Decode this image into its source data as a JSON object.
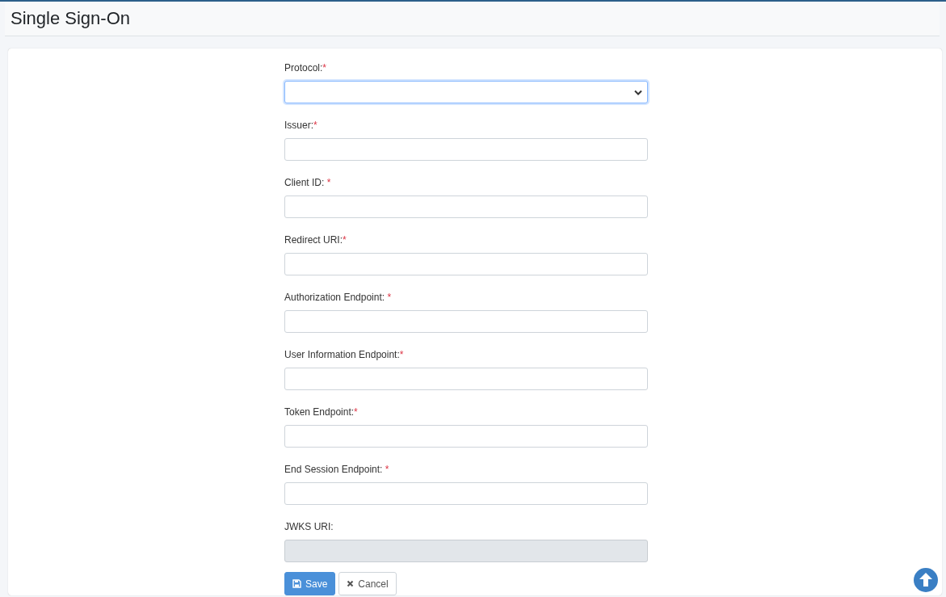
{
  "page_title": "Single Sign-On",
  "fields": [
    {
      "label": "Protocol:",
      "required_mark": "*",
      "kind": "select",
      "focused": true
    },
    {
      "label": "Issuer:",
      "required_mark": "*",
      "kind": "text",
      "disabled": false
    },
    {
      "label": "Client ID: ",
      "required_mark": "*",
      "kind": "text",
      "disabled": false
    },
    {
      "label": "Redirect URI:",
      "required_mark": "*",
      "kind": "text",
      "disabled": false
    },
    {
      "label": "Authorization Endpoint: ",
      "required_mark": "*",
      "kind": "text",
      "disabled": false
    },
    {
      "label": "User Information Endpoint:",
      "required_mark": "*",
      "kind": "text",
      "disabled": false
    },
    {
      "label": "Token Endpoint:",
      "required_mark": "*",
      "kind": "text",
      "disabled": false
    },
    {
      "label": "End Session Endpoint: ",
      "required_mark": "*",
      "kind": "text",
      "disabled": false
    },
    {
      "label": "JWKS URI:",
      "kind": "text",
      "disabled": true
    }
  ],
  "buttons": [
    {
      "label": "Save",
      "kind": "primary"
    },
    {
      "label": "Cancel",
      "kind": "secondary"
    }
  ]
}
